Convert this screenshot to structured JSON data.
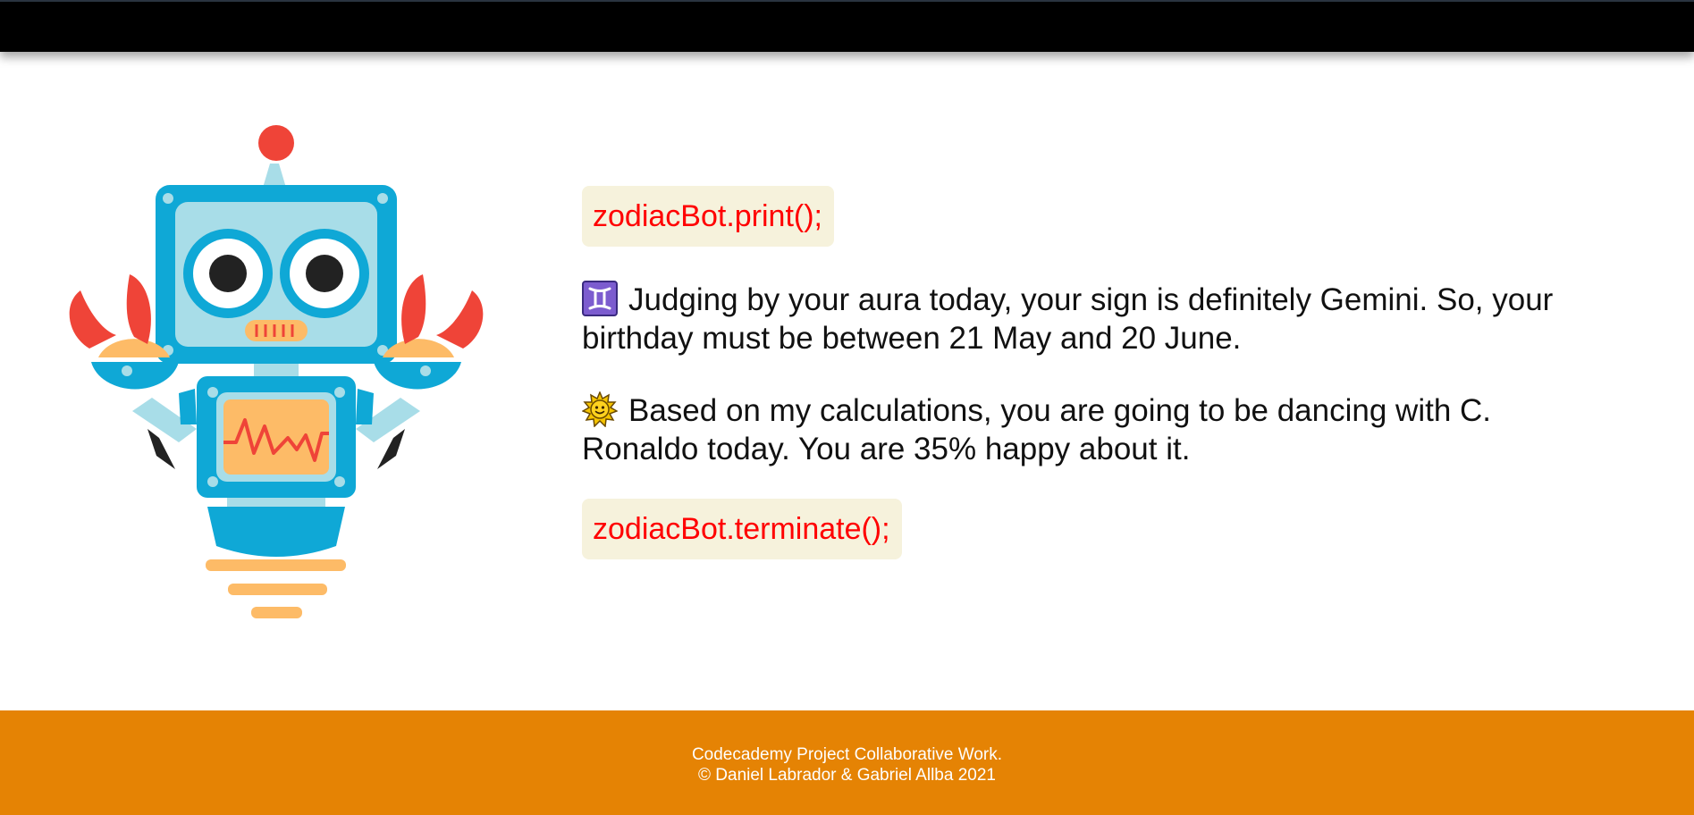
{
  "colors": {
    "header": "#000000",
    "footer": "#e58304",
    "code_text": "#ff0000",
    "code_bg": "#f6f2dc",
    "robot_blue": "#0fa8d6",
    "robot_light": "#a8dde8",
    "robot_red": "#ef4438",
    "robot_orange": "#fdbb67"
  },
  "main": {
    "code_print": "zodiacBot.print();",
    "sign": {
      "icon": "gemini-symbol-icon",
      "text": "Judging by your aura today, your sign is definitely Gemini. So, your birthday must be between 21 May and 20 June."
    },
    "prediction": {
      "icon": "sun-face-icon",
      "text": "Based on my calculations, you are going to be dancing with C. Ronaldo today. You are 35% happy about it."
    },
    "code_terminate": "zodiacBot.terminate();"
  },
  "footer": {
    "line1": "Codecademy Project Collaborative Work.",
    "line2": "© Daniel Labrador & Gabriel Allba 2021"
  }
}
